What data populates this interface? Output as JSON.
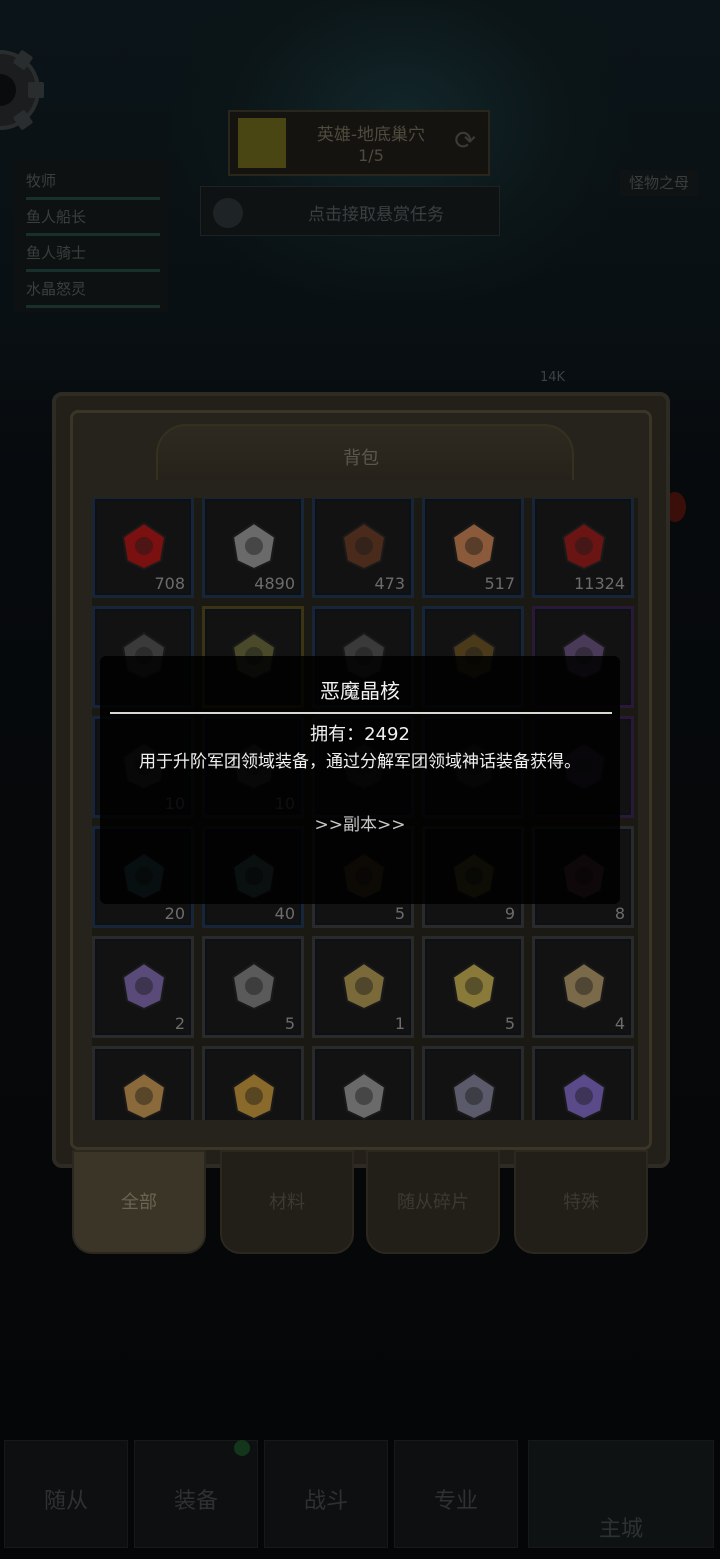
{
  "quest": {
    "title": "英雄-地底巢穴",
    "progress": "1/5"
  },
  "bounty": {
    "label": "点击接取悬赏任务"
  },
  "team": {
    "members": [
      "牧师",
      "鱼人船长",
      "鱼人骑士",
      "水晶怒灵"
    ]
  },
  "boss": {
    "label": "怪物之母",
    "hp": "14K"
  },
  "bag": {
    "title": "背包",
    "items": [
      {
        "count": "708"
      },
      {
        "count": "4890"
      },
      {
        "count": "473"
      },
      {
        "count": "517"
      },
      {
        "count": "11324"
      },
      {
        "count": ""
      },
      {
        "count": ""
      },
      {
        "count": ""
      },
      {
        "count": ""
      },
      {
        "count": ""
      },
      {
        "count": "10"
      },
      {
        "count": "10"
      },
      {
        "count": ""
      },
      {
        "count": ""
      },
      {
        "count": ""
      },
      {
        "count": "20"
      },
      {
        "count": "40"
      },
      {
        "count": "5"
      },
      {
        "count": "9"
      },
      {
        "count": "8"
      },
      {
        "count": "2"
      },
      {
        "count": "5"
      },
      {
        "count": "1"
      },
      {
        "count": "5"
      },
      {
        "count": "4"
      },
      {
        "count": ""
      },
      {
        "count": ""
      },
      {
        "count": ""
      },
      {
        "count": ""
      },
      {
        "count": ""
      }
    ]
  },
  "tabs": [
    "全部",
    "材料",
    "随从碎片",
    "特殊"
  ],
  "tooltip": {
    "title": "恶魔晶核",
    "owned": "拥有：2492",
    "description": "用于升阶军团领域装备，通过分解军团领域神话装备获得。",
    "link": ">>副本>>"
  },
  "nav": [
    "随从",
    "装备",
    "战斗",
    "专业",
    "主城"
  ],
  "colors": {
    "tooltip_bg": "#000000",
    "panel_bg": "#232019",
    "cell_border_blue": "#182536"
  }
}
